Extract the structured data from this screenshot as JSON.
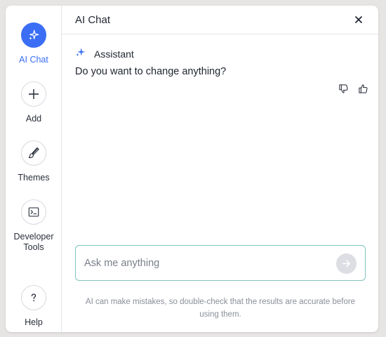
{
  "sidebar": {
    "items": [
      {
        "label": "AI Chat",
        "icon": "sparkle-icon",
        "active": true
      },
      {
        "label": "Add",
        "icon": "plus-icon"
      },
      {
        "label": "Themes",
        "icon": "brush-icon"
      },
      {
        "label": "Developer Tools",
        "icon": "terminal-icon"
      },
      {
        "label": "Help",
        "icon": "question-icon"
      }
    ]
  },
  "header": {
    "title": "AI Chat"
  },
  "chat": {
    "assistant_name": "Assistant",
    "message": "Do you want to change anything?"
  },
  "composer": {
    "placeholder": "Ask me anything",
    "value": ""
  },
  "footer": {
    "disclaimer": "AI can make mistakes, so double-check that the results are accurate before using them."
  },
  "colors": {
    "accent": "#3b6ef5",
    "input_border": "#7fc4bf",
    "send_button": "#dcdee3"
  }
}
